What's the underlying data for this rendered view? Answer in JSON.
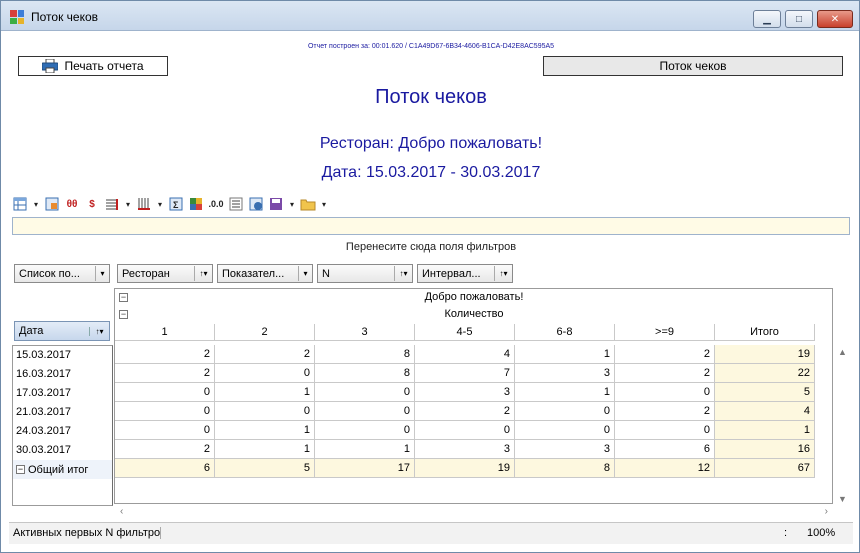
{
  "window": {
    "title": "Поток чеков",
    "buttons": {
      "minimize": "▁",
      "maximize": "□",
      "close": "✕"
    }
  },
  "report": {
    "meta": "Отчет построен за: 00:01.620 / C1A49D67-6B34-4606-B1CA-D42E8AC595A5",
    "print_label": "Печать отчета",
    "stream_label": "Поток чеков",
    "title": "Поток чеков",
    "restaurant_line": "Ресторан: Добро пожаловать!",
    "date_line": "Дата: 15.03.2017 - 30.03.2017"
  },
  "toolbar": {
    "icons": [
      "table-layout-icon",
      "fit-icon",
      "strike-icon",
      "currency-icon",
      "bars-icon",
      "columns-icon",
      "sum-icon",
      "grid-color-icon",
      "decimal-icon",
      "list-icon",
      "info-icon",
      "save-icon",
      "folder-icon"
    ]
  },
  "pivot": {
    "drop_hint": "Перенесите сюда поля фильтров",
    "filter_fields": [
      {
        "label": "Список по...",
        "ctl": "▾"
      },
      {
        "label": "Ресторан",
        "ctl": "↑▾"
      },
      {
        "label": "Показател...",
        "ctl": "▾"
      },
      {
        "label": "N",
        "ctl": "↑▾"
      },
      {
        "label": "Интервал...",
        "ctl": "↑▾"
      }
    ],
    "column_group": "Добро пожаловать!",
    "measure": "Количество",
    "columns": [
      "1",
      "2",
      "3",
      "4-5",
      "6-8",
      ">=9",
      "Итого"
    ],
    "row_field": "Дата",
    "row_field_ctl": "↑▾",
    "rows": [
      {
        "label": "15.03.2017",
        "values": [
          "2",
          "2",
          "8",
          "4",
          "1",
          "2",
          "19"
        ]
      },
      {
        "label": "16.03.2017",
        "values": [
          "2",
          "0",
          "8",
          "7",
          "3",
          "2",
          "22"
        ]
      },
      {
        "label": "17.03.2017",
        "values": [
          "0",
          "1",
          "0",
          "3",
          "1",
          "0",
          "5"
        ]
      },
      {
        "label": "21.03.2017",
        "values": [
          "0",
          "0",
          "0",
          "2",
          "0",
          "2",
          "4"
        ]
      },
      {
        "label": "24.03.2017",
        "values": [
          "0",
          "1",
          "0",
          "0",
          "0",
          "0",
          "1"
        ]
      },
      {
        "label": "30.03.2017",
        "values": [
          "2",
          "1",
          "1",
          "3",
          "3",
          "6",
          "16"
        ]
      }
    ],
    "total_row": {
      "label": "Общий итог",
      "values": [
        "6",
        "5",
        "17",
        "19",
        "8",
        "12",
        "67"
      ]
    }
  },
  "status": {
    "left": "Активных первых N фильтров",
    "colon": ":",
    "zoom": "100%"
  }
}
